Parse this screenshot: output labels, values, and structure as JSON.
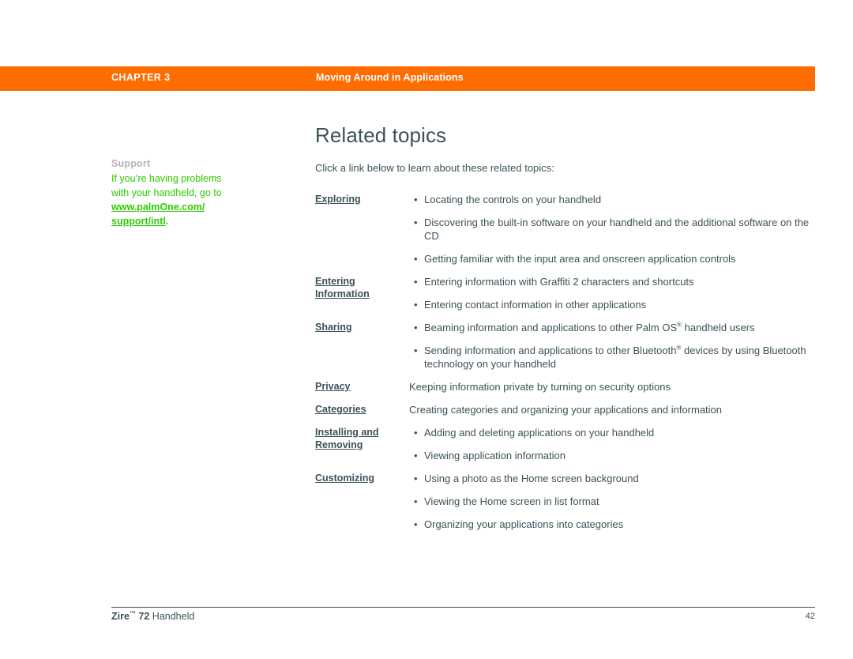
{
  "header": {
    "chapter_label": "CHAPTER 3",
    "chapter_title": "Moving Around in Applications",
    "bar_color": "#ff6c00",
    "text_color": "#ffffff"
  },
  "sidebar": {
    "heading": "Support",
    "heading_color": "#b3b3b3",
    "text_color": "#2ecc00",
    "line1": "If you’re having problems",
    "line2": "with your handheld, go to",
    "link_line1": "www.palmOne.com/",
    "link_line2": "support/intl",
    "trailing_period": "."
  },
  "main": {
    "title": "Related topics",
    "title_color": "#3c5158",
    "intro": "Click a link below to learn about these related topics:"
  },
  "topics": [
    {
      "link_lines": [
        "Exploring"
      ],
      "items": [
        {
          "bullet": "•",
          "text": "Locating the controls on your handheld"
        },
        {
          "bullet": "•",
          "text": "Discovering the built-in software on your handheld and the additional software on the CD"
        },
        {
          "bullet": "•",
          "text": "Getting familiar with the input area and onscreen application controls"
        }
      ]
    },
    {
      "link_lines": [
        "Entering ",
        "Information"
      ],
      "items": [
        {
          "bullet": "•",
          "text": "Entering information with Graffiti 2 characters and shortcuts"
        },
        {
          "bullet": "•",
          "text": "Entering contact information in other applications"
        }
      ]
    },
    {
      "link_lines": [
        "Sharing"
      ],
      "items": [
        {
          "bullet": "•",
          "text_pre": "Beaming information and applications to other Palm OS",
          "sup": "®",
          "text_post": " handheld users"
        },
        {
          "bullet": "•",
          "text_pre": "Sending information and applications to other Bluetooth",
          "sup": "®",
          "text_post": " devices by using Bluetooth technology on your handheld"
        }
      ]
    },
    {
      "link_lines": [
        "Privacy"
      ],
      "items": [
        {
          "bullet": "",
          "text": "Keeping information private by turning on security options"
        }
      ]
    },
    {
      "link_lines": [
        "Categories"
      ],
      "items": [
        {
          "bullet": "",
          "text": "Creating categories and organizing your applications and information"
        }
      ]
    },
    {
      "link_lines": [
        "Installing and ",
        "Removing"
      ],
      "items": [
        {
          "bullet": "•",
          "text": "Adding and deleting applications on your handheld"
        },
        {
          "bullet": "•",
          "text": "Viewing application information"
        }
      ]
    },
    {
      "link_lines": [
        "Customizing"
      ],
      "items": [
        {
          "bullet": "•",
          "text": "Using a photo as the Home screen background"
        },
        {
          "bullet": "•",
          "text": "Viewing the Home screen in list format"
        },
        {
          "bullet": "•",
          "text": "Organizing your applications into categories"
        }
      ]
    }
  ],
  "footer": {
    "brand": "Zire",
    "trademark": "™",
    "model": " 72",
    "product": " Handheld",
    "page_number": "42"
  }
}
